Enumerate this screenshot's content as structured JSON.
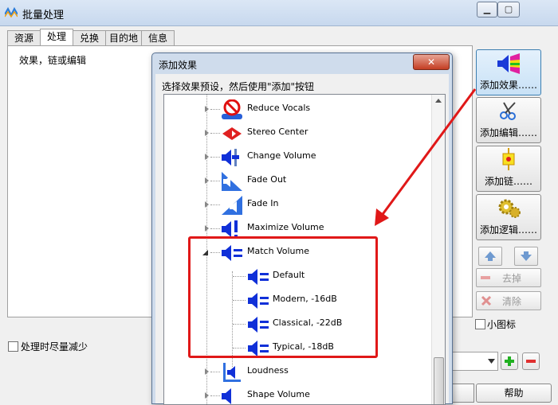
{
  "window": {
    "title": "批量处理"
  },
  "tabs": [
    {
      "label": "资源"
    },
    {
      "label": "处理"
    },
    {
      "label": "兑换"
    },
    {
      "label": "目的地"
    },
    {
      "label": "信息"
    }
  ],
  "panel": {
    "label": "效果，链或编辑"
  },
  "footer": {
    "minimize_label": "处理时尽量减少",
    "small_icon_label": "小图标",
    "help_label": "帮助"
  },
  "sidebar": {
    "add_effect": "添加效果……",
    "add_edit": "添加编辑……",
    "add_chain": "添加链……",
    "add_logic": "添加逻辑……",
    "remove": "去掉",
    "clear": "清除"
  },
  "dialog": {
    "title": "添加效果",
    "instruction": "选择效果预设，然后使用\"添加\"按钮",
    "close_label": "✕",
    "items": [
      {
        "label": "Reduce Vocals",
        "icon": "reduce-vocals-icon"
      },
      {
        "label": "Stereo Center",
        "icon": "stereo-center-icon"
      },
      {
        "label": "Change Volume",
        "icon": "change-volume-icon"
      },
      {
        "label": "Fade Out",
        "icon": "fade-out-icon"
      },
      {
        "label": "Fade In",
        "icon": "fade-in-icon"
      },
      {
        "label": "Maximize Volume",
        "icon": "maximize-volume-icon"
      },
      {
        "label": "Match Volume",
        "icon": "match-volume-icon"
      },
      {
        "label": "Default",
        "icon": "match-volume-icon"
      },
      {
        "label": "Modern, -16dB",
        "icon": "match-volume-icon"
      },
      {
        "label": "Classical, -22dB",
        "icon": "match-volume-icon"
      },
      {
        "label": "Typical, -18dB",
        "icon": "match-volume-icon"
      },
      {
        "label": "Loudness",
        "icon": "loudness-icon"
      },
      {
        "label": "Shape Volume",
        "icon": "shape-volume-icon"
      }
    ]
  },
  "colors": {
    "accent": "#1030d8",
    "highlight": "#e01818"
  }
}
